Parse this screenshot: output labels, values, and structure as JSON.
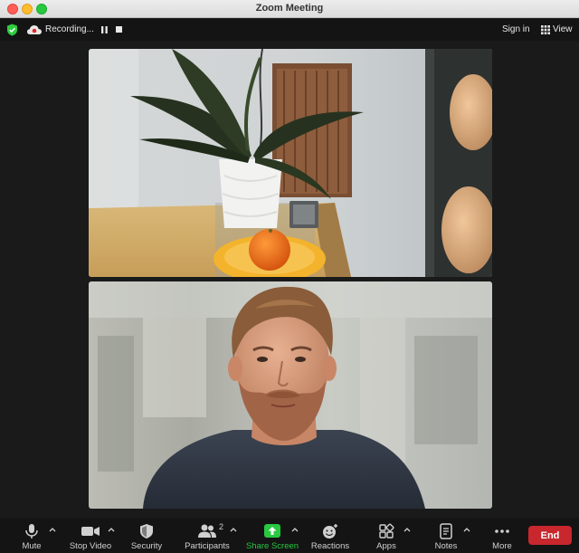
{
  "window": {
    "title": "Zoom Meeting"
  },
  "top_bar": {
    "recording_label": "Recording...",
    "sign_in_label": "Sign in",
    "view_label": "View"
  },
  "toolbar": {
    "items": [
      {
        "label": "Mute",
        "icon": "microphone-icon"
      },
      {
        "label": "Stop Video",
        "icon": "video-camera-icon"
      },
      {
        "label": "Security",
        "icon": "shield-icon"
      },
      {
        "label": "Participants",
        "icon": "participants-icon",
        "count": "2"
      },
      {
        "label": "Share Screen",
        "icon": "share-screen-icon"
      },
      {
        "label": "Reactions",
        "icon": "reactions-icon"
      },
      {
        "label": "Apps",
        "icon": "apps-icon"
      },
      {
        "label": "Notes",
        "icon": "notes-icon"
      },
      {
        "label": "More",
        "icon": "more-icon"
      }
    ],
    "end_label": "End"
  },
  "colors": {
    "end_button": "#c8272d",
    "share_screen_accent": "#28c840",
    "security_shield": "#2ecc40",
    "background": "#141414"
  }
}
